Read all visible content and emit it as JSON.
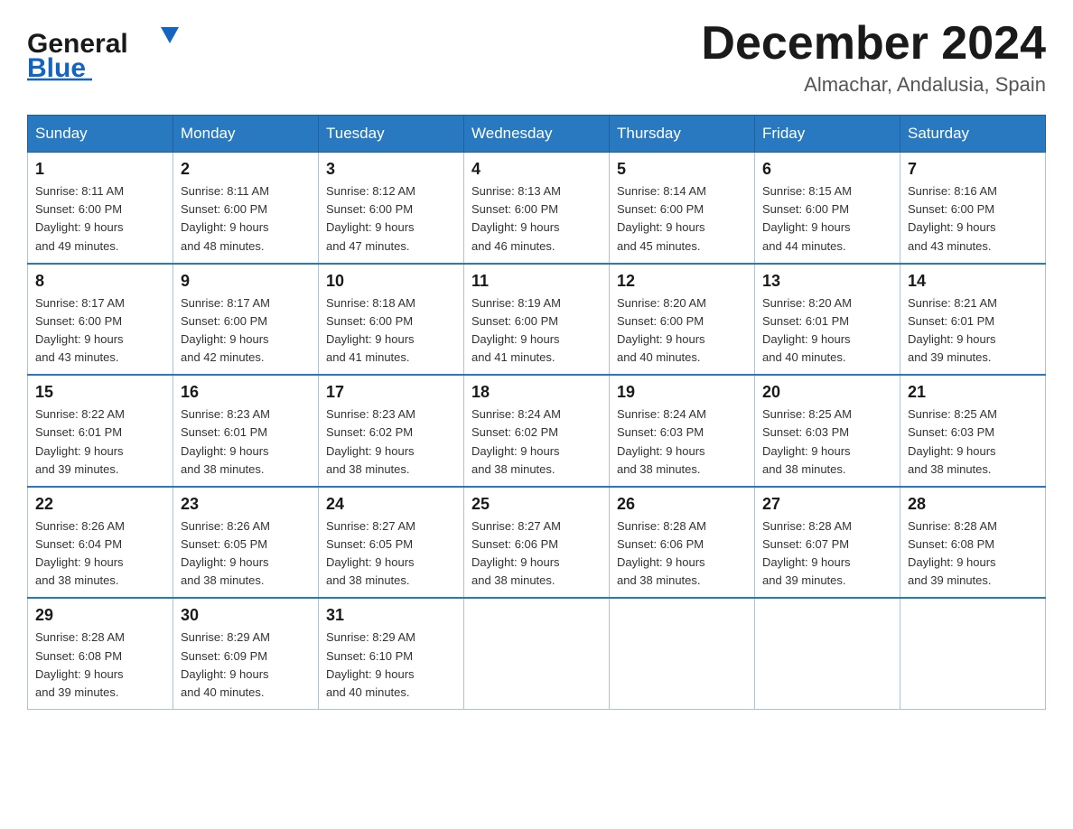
{
  "header": {
    "logo_general": "General",
    "logo_blue": "Blue",
    "month_title": "December 2024",
    "location": "Almachar, Andalusia, Spain"
  },
  "days_of_week": [
    "Sunday",
    "Monday",
    "Tuesday",
    "Wednesday",
    "Thursday",
    "Friday",
    "Saturday"
  ],
  "weeks": [
    [
      {
        "day": "1",
        "sunrise": "8:11 AM",
        "sunset": "6:00 PM",
        "daylight": "9 hours and 49 minutes."
      },
      {
        "day": "2",
        "sunrise": "8:11 AM",
        "sunset": "6:00 PM",
        "daylight": "9 hours and 48 minutes."
      },
      {
        "day": "3",
        "sunrise": "8:12 AM",
        "sunset": "6:00 PM",
        "daylight": "9 hours and 47 minutes."
      },
      {
        "day": "4",
        "sunrise": "8:13 AM",
        "sunset": "6:00 PM",
        "daylight": "9 hours and 46 minutes."
      },
      {
        "day": "5",
        "sunrise": "8:14 AM",
        "sunset": "6:00 PM",
        "daylight": "9 hours and 45 minutes."
      },
      {
        "day": "6",
        "sunrise": "8:15 AM",
        "sunset": "6:00 PM",
        "daylight": "9 hours and 44 minutes."
      },
      {
        "day": "7",
        "sunrise": "8:16 AM",
        "sunset": "6:00 PM",
        "daylight": "9 hours and 43 minutes."
      }
    ],
    [
      {
        "day": "8",
        "sunrise": "8:17 AM",
        "sunset": "6:00 PM",
        "daylight": "9 hours and 43 minutes."
      },
      {
        "day": "9",
        "sunrise": "8:17 AM",
        "sunset": "6:00 PM",
        "daylight": "9 hours and 42 minutes."
      },
      {
        "day": "10",
        "sunrise": "8:18 AM",
        "sunset": "6:00 PM",
        "daylight": "9 hours and 41 minutes."
      },
      {
        "day": "11",
        "sunrise": "8:19 AM",
        "sunset": "6:00 PM",
        "daylight": "9 hours and 41 minutes."
      },
      {
        "day": "12",
        "sunrise": "8:20 AM",
        "sunset": "6:00 PM",
        "daylight": "9 hours and 40 minutes."
      },
      {
        "day": "13",
        "sunrise": "8:20 AM",
        "sunset": "6:01 PM",
        "daylight": "9 hours and 40 minutes."
      },
      {
        "day": "14",
        "sunrise": "8:21 AM",
        "sunset": "6:01 PM",
        "daylight": "9 hours and 39 minutes."
      }
    ],
    [
      {
        "day": "15",
        "sunrise": "8:22 AM",
        "sunset": "6:01 PM",
        "daylight": "9 hours and 39 minutes."
      },
      {
        "day": "16",
        "sunrise": "8:23 AM",
        "sunset": "6:01 PM",
        "daylight": "9 hours and 38 minutes."
      },
      {
        "day": "17",
        "sunrise": "8:23 AM",
        "sunset": "6:02 PM",
        "daylight": "9 hours and 38 minutes."
      },
      {
        "day": "18",
        "sunrise": "8:24 AM",
        "sunset": "6:02 PM",
        "daylight": "9 hours and 38 minutes."
      },
      {
        "day": "19",
        "sunrise": "8:24 AM",
        "sunset": "6:03 PM",
        "daylight": "9 hours and 38 minutes."
      },
      {
        "day": "20",
        "sunrise": "8:25 AM",
        "sunset": "6:03 PM",
        "daylight": "9 hours and 38 minutes."
      },
      {
        "day": "21",
        "sunrise": "8:25 AM",
        "sunset": "6:03 PM",
        "daylight": "9 hours and 38 minutes."
      }
    ],
    [
      {
        "day": "22",
        "sunrise": "8:26 AM",
        "sunset": "6:04 PM",
        "daylight": "9 hours and 38 minutes."
      },
      {
        "day": "23",
        "sunrise": "8:26 AM",
        "sunset": "6:05 PM",
        "daylight": "9 hours and 38 minutes."
      },
      {
        "day": "24",
        "sunrise": "8:27 AM",
        "sunset": "6:05 PM",
        "daylight": "9 hours and 38 minutes."
      },
      {
        "day": "25",
        "sunrise": "8:27 AM",
        "sunset": "6:06 PM",
        "daylight": "9 hours and 38 minutes."
      },
      {
        "day": "26",
        "sunrise": "8:28 AM",
        "sunset": "6:06 PM",
        "daylight": "9 hours and 38 minutes."
      },
      {
        "day": "27",
        "sunrise": "8:28 AM",
        "sunset": "6:07 PM",
        "daylight": "9 hours and 39 minutes."
      },
      {
        "day": "28",
        "sunrise": "8:28 AM",
        "sunset": "6:08 PM",
        "daylight": "9 hours and 39 minutes."
      }
    ],
    [
      {
        "day": "29",
        "sunrise": "8:28 AM",
        "sunset": "6:08 PM",
        "daylight": "9 hours and 39 minutes."
      },
      {
        "day": "30",
        "sunrise": "8:29 AM",
        "sunset": "6:09 PM",
        "daylight": "9 hours and 40 minutes."
      },
      {
        "day": "31",
        "sunrise": "8:29 AM",
        "sunset": "6:10 PM",
        "daylight": "9 hours and 40 minutes."
      },
      null,
      null,
      null,
      null
    ]
  ],
  "labels": {
    "sunrise": "Sunrise:",
    "sunset": "Sunset:",
    "daylight": "Daylight:"
  }
}
